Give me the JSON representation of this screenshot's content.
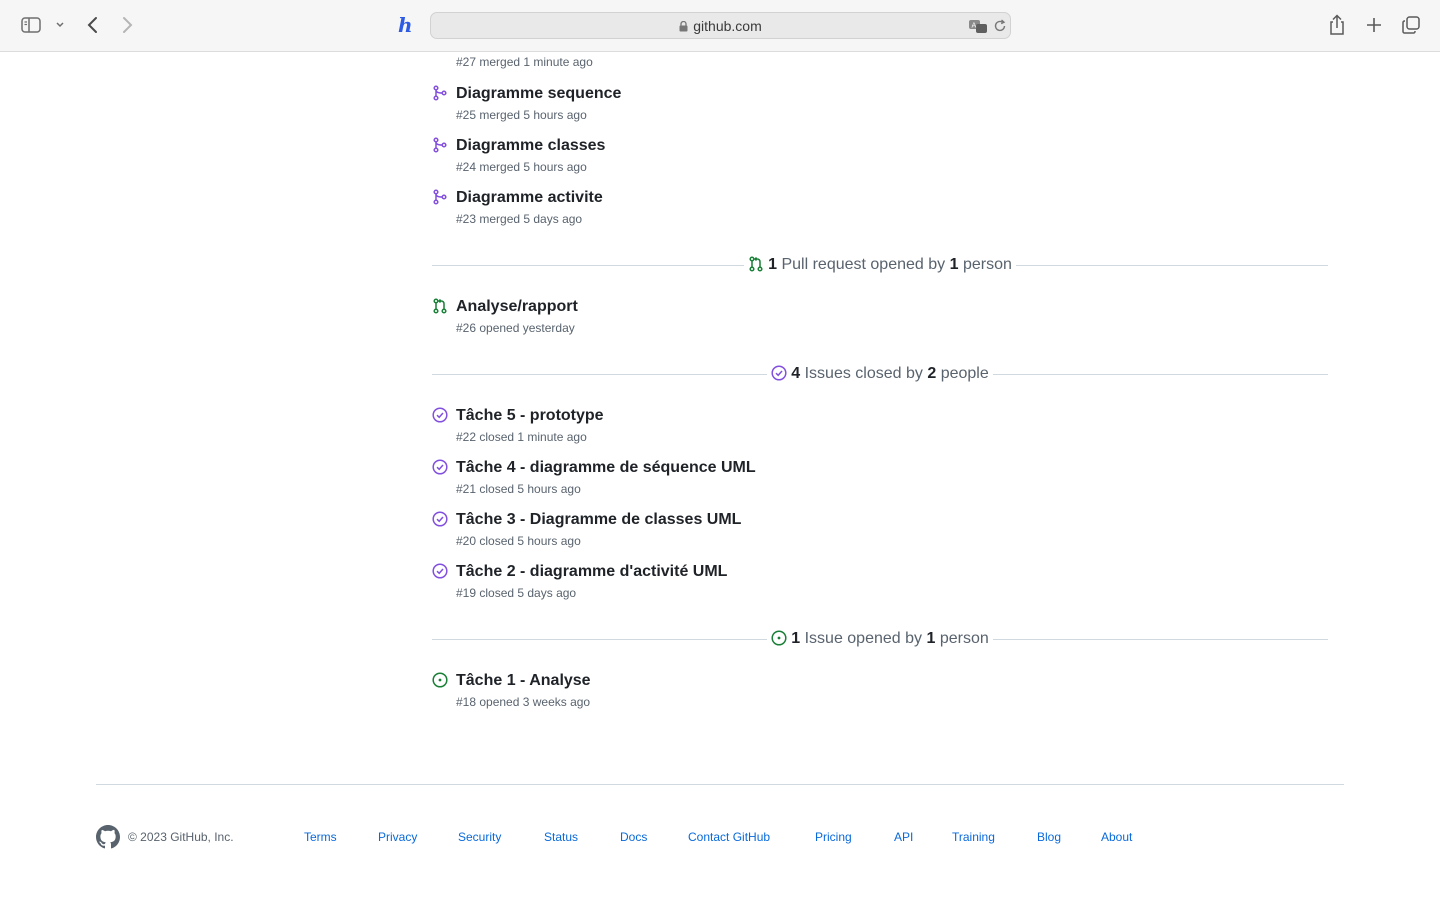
{
  "browser": {
    "url": "github.com"
  },
  "top_item": {
    "meta": "#27 merged 1 minute ago"
  },
  "merged": [
    {
      "title": "Diagramme sequence",
      "meta": "#25 merged 5 hours ago"
    },
    {
      "title": "Diagramme classes",
      "meta": "#24 merged 5 hours ago"
    },
    {
      "title": "Diagramme activite",
      "meta": "#23 merged 5 days ago"
    }
  ],
  "pr_opened_divider": {
    "count": "1",
    "text_mid": "Pull request opened by",
    "people": "1",
    "text_end": "person"
  },
  "pr_opened": [
    {
      "title": "Analyse/rapport",
      "meta": "#26 opened yesterday"
    }
  ],
  "issues_closed_divider": {
    "count": "4",
    "text_mid": "Issues closed by",
    "people": "2",
    "text_end": "people"
  },
  "issues_closed": [
    {
      "title": "Tâche 5 - prototype",
      "meta": "#22 closed 1 minute ago"
    },
    {
      "title": "Tâche 4 - diagramme de séquence UML",
      "meta": "#21 closed 5 hours ago"
    },
    {
      "title": "Tâche 3 - Diagramme de classes UML",
      "meta": "#20 closed 5 hours ago"
    },
    {
      "title": "Tâche 2 - diagramme d'activité UML",
      "meta": "#19 closed 5 days ago"
    }
  ],
  "issues_opened_divider": {
    "count": "1",
    "text_mid": "Issue opened by",
    "people": "1",
    "text_end": "person"
  },
  "issues_opened": [
    {
      "title": "Tâche 1 - Analyse",
      "meta": "#18 opened 3 weeks ago"
    }
  ],
  "footer": {
    "copyright": "© 2023 GitHub, Inc.",
    "links": [
      "Terms",
      "Privacy",
      "Security",
      "Status",
      "Docs",
      "Contact GitHub",
      "Pricing",
      "API",
      "Training",
      "Blog",
      "About"
    ]
  },
  "colors": {
    "merged": "#8250df",
    "open": "#1a7f37",
    "closed": "#8250df",
    "link": "#0969da"
  }
}
